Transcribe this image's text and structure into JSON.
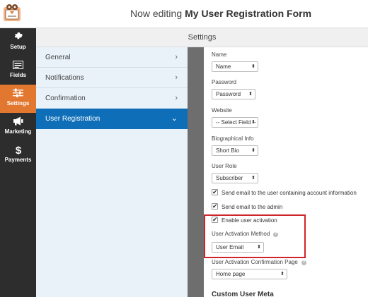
{
  "header": {
    "editing_prefix": "Now editing",
    "form_name": "My User Registration Form"
  },
  "nav": [
    {
      "label": "Setup",
      "icon": "gear-icon"
    },
    {
      "label": "Fields",
      "icon": "fields-icon"
    },
    {
      "label": "Settings",
      "icon": "sliders-icon",
      "active": true
    },
    {
      "label": "Marketing",
      "icon": "megaphone-icon"
    },
    {
      "label": "Payments",
      "icon": "dollar-icon"
    }
  ],
  "settings_title": "Settings",
  "panels": [
    {
      "label": "General",
      "chevron": "›"
    },
    {
      "label": "Notifications",
      "chevron": "›"
    },
    {
      "label": "Confirmation",
      "chevron": "›"
    },
    {
      "label": "User Registration",
      "chevron": "⌄",
      "active": true
    }
  ],
  "fields": {
    "name": {
      "label": "Name",
      "value": "Name"
    },
    "password": {
      "label": "Password",
      "value": "Password"
    },
    "website": {
      "label": "Website",
      "value": "-- Select Field --"
    },
    "bio": {
      "label": "Biographical Info",
      "value": "Short Bio"
    },
    "role": {
      "label": "User Role",
      "value": "Subscriber"
    }
  },
  "checkboxes": {
    "email_user": {
      "label": "Send email to the user containing account information",
      "checked": true
    },
    "email_admin": {
      "label": "Send email to the admin",
      "checked": true
    },
    "activation": {
      "label": "Enable user activation",
      "checked": true
    }
  },
  "activation_method": {
    "label": "User Activation Method",
    "value": "User Email"
  },
  "confirmation_page": {
    "label": "User Activation Confirmation Page",
    "value": "Home page"
  },
  "custom_meta_heading": "Custom User Meta",
  "arrows_glyph": "⬍",
  "check_glyph": "✔",
  "help_glyph": "?",
  "colors": {
    "active_nav": "#e27730",
    "active_panel": "#0e6fb8",
    "highlight_box": "#d0232a"
  }
}
